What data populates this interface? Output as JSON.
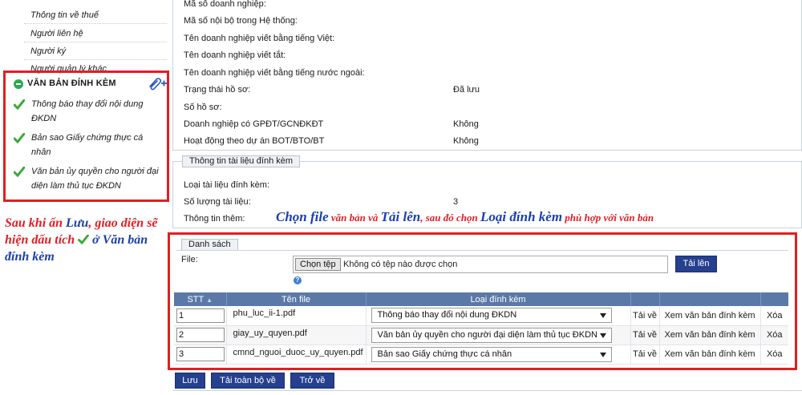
{
  "sidebar": {
    "items_top": [
      "Thông tin về thuế",
      "Người liên hệ",
      "Người ký",
      "Người quản lý khác"
    ],
    "attach_section": {
      "title": "VĂN BẢN ĐÍNH KÈM",
      "items": [
        {
          "line1": "Thông báo thay đổi nội dung",
          "line2": "ĐKDN"
        },
        {
          "line1": "Bản sao Giấy chứng thực cá",
          "line2": "nhân"
        },
        {
          "line1": "Văn bản ủy quyền cho người đại",
          "line2": "diện làm thủ tục ĐKDN"
        }
      ]
    },
    "annotation": {
      "part1": "Sau khi ấn ",
      "part2": "Lưu",
      "part3": ", giao diện sẽ hiện dấu tích ",
      "part4": " ở Văn bản đính kèm"
    }
  },
  "company_info": {
    "rows": [
      {
        "label": "Mã số doanh nghiệp:",
        "value": ""
      },
      {
        "label": "Mã số nội bộ trong Hệ thống:",
        "value": ""
      },
      {
        "label": "Tên doanh nghiệp viết bằng tiếng Việt:",
        "value": ""
      },
      {
        "label": "Tên doanh nghiệp viết tắt:",
        "value": ""
      },
      {
        "label": "Tên doanh nghiệp viết bằng tiếng nước ngoài:",
        "value": ""
      },
      {
        "label": "Trạng thái hồ sơ:",
        "value": "Đã lưu"
      },
      {
        "label": "Số hồ sơ:",
        "value": ""
      },
      {
        "label": "Doanh nghiệp có GPĐT/GCNĐKĐT",
        "value": "Không"
      },
      {
        "label": "Hoạt động theo dự án BOT/BTO/BT",
        "value": "Không"
      }
    ]
  },
  "attach_info": {
    "tab": "Thông tin tài liệu đính kèm",
    "rows": [
      {
        "label": "Loại tài liệu đính kèm:",
        "value": ""
      },
      {
        "label": "Số lượng tài liệu:",
        "value": "3"
      },
      {
        "label": "Thông tin thêm:",
        "value": ""
      }
    ]
  },
  "annotation_top": {
    "p1": "Chọn ",
    "p2": "file",
    "p3": " văn bản và ",
    "p4": "Tải lên",
    "p5": ", sau đó chọn ",
    "p6": "Loại đính kèm",
    "p7": " phù hợp với văn bản"
  },
  "list": {
    "tab": "Danh sách",
    "file_label": "File:",
    "choose_button": "Chọn tệp",
    "no_file": "Không có tệp nào được chọn",
    "upload_button": "Tải lên",
    "columns": [
      "STT",
      "Tên file",
      "Loại đính kèm"
    ],
    "rows": [
      {
        "stt": "1",
        "file": "phu_luc_ii-1.pdf",
        "type": "Thông báo thay đổi nội dung ĐKDN",
        "download": "Tải về",
        "view": "Xem văn bản đính kèm",
        "delete": "Xóa"
      },
      {
        "stt": "2",
        "file": "giay_uy_quyen.pdf",
        "type": "Văn bản ủy quyền cho người đại diện làm thủ tục ĐKDN",
        "download": "Tải về",
        "view": "Xem văn bản đính kèm",
        "delete": "Xóa"
      },
      {
        "stt": "3",
        "file": "cmnd_nguoi_duoc_uy_quyen.pdf",
        "type": "Bản sao Giấy chứng thực cá nhân",
        "download": "Tải về",
        "view": "Xem văn bản đính kèm",
        "delete": "Xóa"
      }
    ]
  },
  "actions": {
    "save": "Lưu",
    "download_all": "Tải toàn bộ về",
    "back": "Trở về"
  },
  "colors": {
    "accent_red": "#e41d23",
    "button_blue": "#25408f",
    "header_blue": "#5b79a7",
    "check_green": "#3aa935"
  }
}
